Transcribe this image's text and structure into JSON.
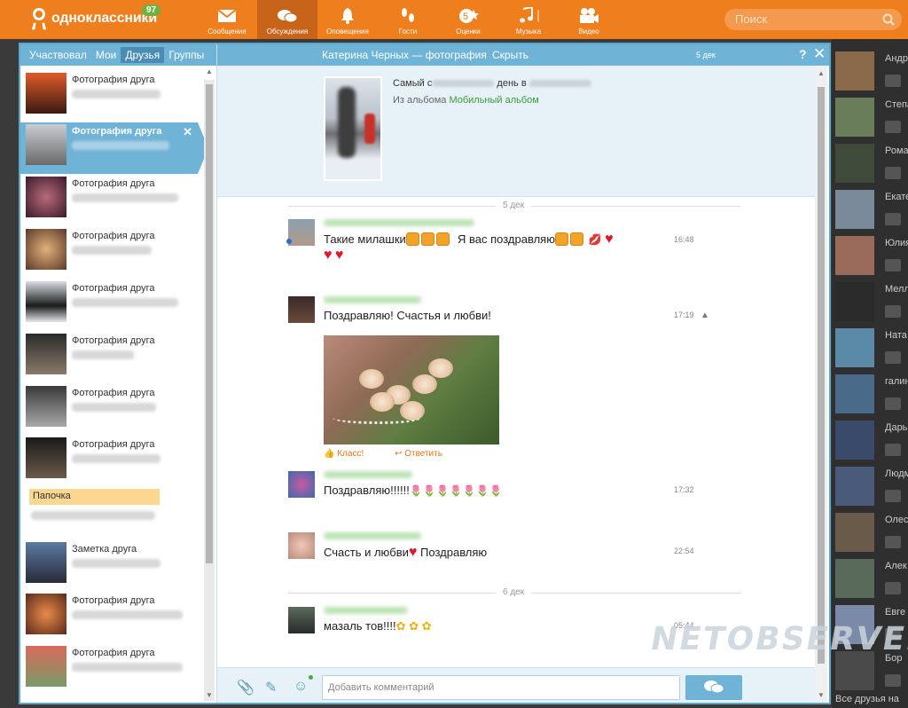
{
  "topbar": {
    "logo_text": "одноклассники",
    "badge": "97",
    "nav": [
      {
        "label": "Сообщения",
        "icon": "envelope-icon"
      },
      {
        "label": "Обсуждения",
        "icon": "chat-bubbles-icon"
      },
      {
        "label": "Оповещения",
        "icon": "bell-icon"
      },
      {
        "label": "Гости",
        "icon": "footprints-icon"
      },
      {
        "label": "Оценки",
        "icon": "star-rating-icon"
      },
      {
        "label": "Музыка",
        "icon": "music-note-icon"
      },
      {
        "label": "Видео",
        "icon": "video-camera-icon"
      }
    ],
    "search_placeholder": "Поиск"
  },
  "left": {
    "tabs": [
      "Участвовал",
      "Мои",
      "Друзья",
      "Группы"
    ],
    "active_tab": "Друзья",
    "items": [
      {
        "title": "Фотография друга"
      },
      {
        "title": "Фотография друга"
      },
      {
        "title": "Фотография друга"
      },
      {
        "title": "Фотография друга"
      },
      {
        "title": "Фотография друга"
      },
      {
        "title": "Фотография друга"
      },
      {
        "title": "Фотография друга"
      },
      {
        "title": "Фотография друга"
      },
      {
        "title": "Заметка друга"
      },
      {
        "title": "Фотография друга"
      },
      {
        "title": "Фотография друга"
      }
    ],
    "note_label": "Папочка"
  },
  "chat": {
    "header_title": "Катерина Черных — фотография",
    "hide_label": "Скрыть",
    "header_date": "5 дек",
    "help": "?",
    "close": "✕",
    "topic_line1_prefix": "Самый с",
    "topic_line1_mid": "день в",
    "topic_album_prefix": "Из альбома",
    "topic_album_name": "Мобильный альбом",
    "date_sep_1": "5 дек",
    "date_sep_2": "6 дек",
    "messages": [
      {
        "text": "Такие милашки",
        "text2": "Я вас поздравляю",
        "time": "16:48"
      },
      {
        "text": "Поздравляю! Счастья и любви!",
        "time": "17:19"
      },
      {
        "text": "Поздравляю!!!!!!",
        "time": "17:32"
      },
      {
        "text": "Счасть и любви",
        "text2": "Поздравляю",
        "time": "22:54"
      },
      {
        "text": "мазаль тов!!!!",
        "time": "05:44"
      }
    ],
    "action_like": "Класс!",
    "action_reply": "Ответить",
    "composer_placeholder": "Добавить комментарий"
  },
  "friends_strip": {
    "names": [
      "Андр",
      "Степа",
      "Рома",
      "Екате",
      "Юлия",
      "Мелл",
      "Ната",
      "галин",
      "Дарь",
      "Людм",
      "Олес",
      "Алек",
      "Евге",
      "Бор"
    ],
    "all_label": "Все друзья на"
  },
  "watermark": "NETOBSERVER.RU",
  "colors": {
    "brand_orange": "#ef7e1d",
    "window_blue": "#6fb3d6",
    "accent_green": "#3a9a3a"
  }
}
